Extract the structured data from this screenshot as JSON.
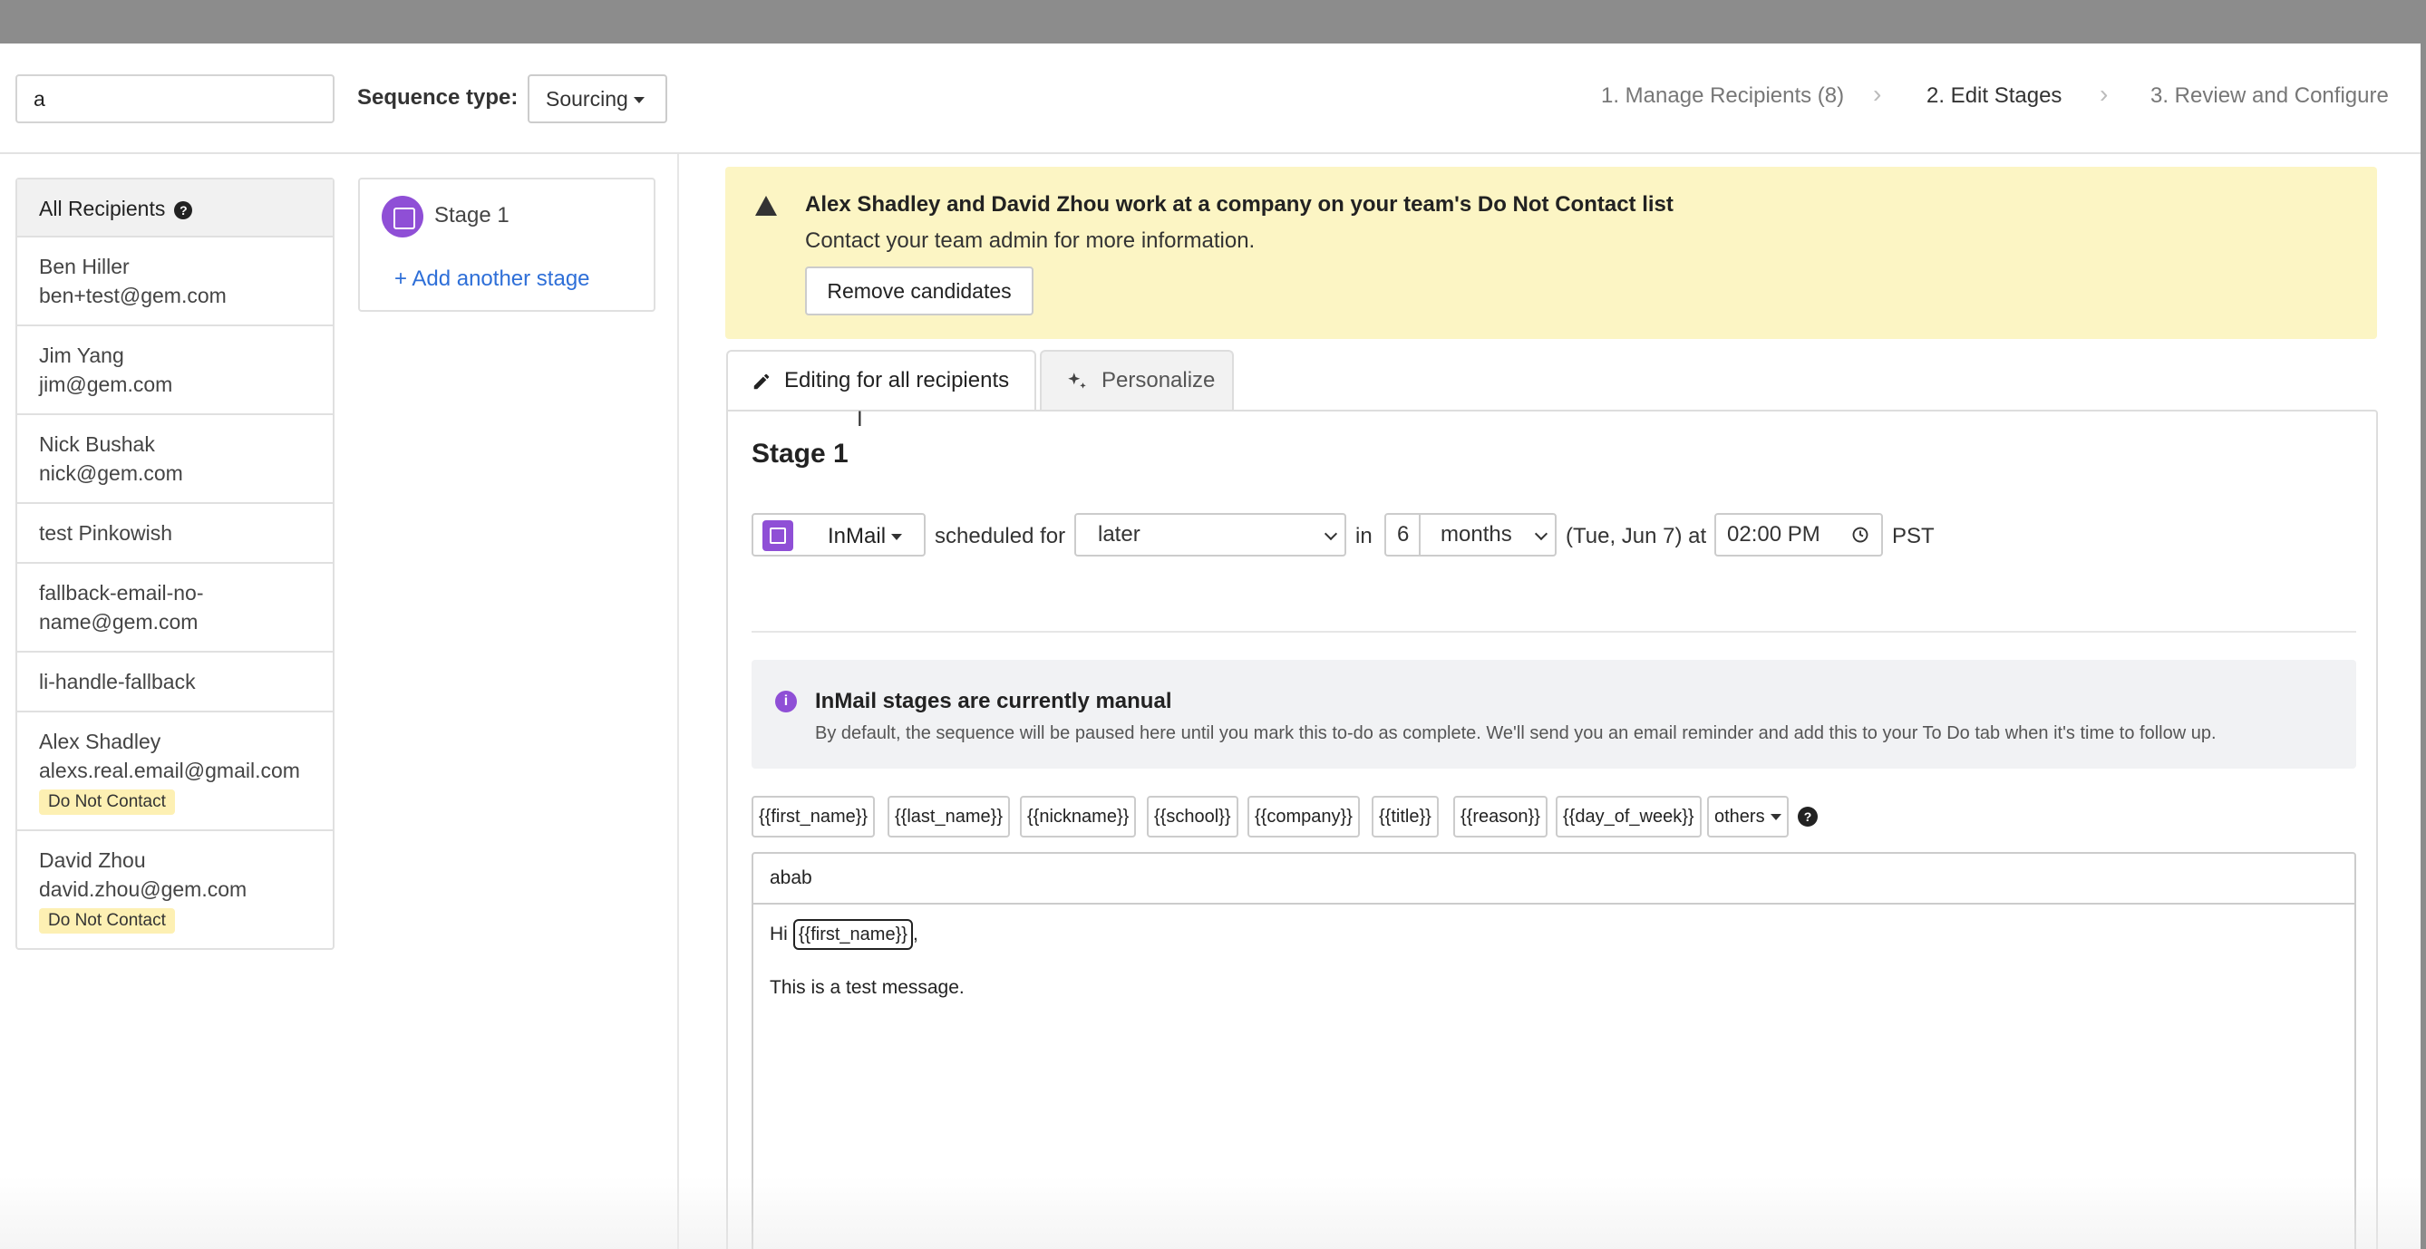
{
  "header": {
    "search_value": "a",
    "sequence_type_label": "Sequence type:",
    "sequence_type_value": "Sourcing",
    "steps": [
      "1. Manage Recipients (8)",
      "2. Edit Stages",
      "3. Review and Configure"
    ],
    "step_separator": "›"
  },
  "recipients": {
    "all_label": "All Recipients",
    "help_glyph": "?",
    "items": [
      {
        "name": "Ben Hiller",
        "email": "ben+test@gem.com",
        "badge": ""
      },
      {
        "name": "Jim Yang",
        "email": "jim@gem.com",
        "badge": ""
      },
      {
        "name": "Nick Bushak",
        "email": "nick@gem.com",
        "badge": ""
      },
      {
        "name": "test Pinkowish",
        "email": "",
        "badge": ""
      },
      {
        "name": "fallback-email-no-",
        "email": "name@gem.com",
        "badge": ""
      },
      {
        "name": "li-handle-fallback",
        "email": "",
        "badge": ""
      },
      {
        "name": "Alex Shadley",
        "email": "alexs.real.email@gmail.com",
        "badge": "Do Not Contact"
      },
      {
        "name": "David Zhou",
        "email": "david.zhou@gem.com",
        "badge": "Do Not Contact"
      }
    ]
  },
  "stages": {
    "items": [
      {
        "label": "Stage 1"
      }
    ],
    "add_label": "+ Add another stage"
  },
  "alert": {
    "title": "Alex Shadley and David Zhou work at a company on your team's Do Not Contact list",
    "subtitle": "Contact your team admin for more information.",
    "button_label": "Remove candidates"
  },
  "tabs": {
    "editing_label": "Editing for all recipients",
    "personalize_label": "Personalize"
  },
  "stage_editor": {
    "title": "Stage 1",
    "type_label": "InMail",
    "scheduled_for_label": "scheduled for",
    "timing_value": "later",
    "in_label": "in",
    "amount_value": "6",
    "unit_value": "months",
    "date_text": "(Tue, Jun 7) at",
    "time_value": "02:00 PM",
    "timezone": "PST",
    "info_title": "InMail stages are currently manual",
    "info_body": "By default, the sequence will be paused here until you mark this to-do as complete. We'll send you an email reminder and add this to your To Do tab when it's time to follow up.",
    "info_glyph": "i",
    "tokens": [
      "{{first_name}}",
      "{{last_name}}",
      "{{nickname}}",
      "{{school}}",
      "{{company}}",
      "{{title}}",
      "{{reason}}",
      "{{day_of_week}}"
    ],
    "others_label": "others",
    "help_glyph": "?",
    "subject": "abab",
    "body_greeting": "Hi",
    "body_token": "{{first_name}}",
    "body_comma": ",",
    "body_line2": "This is a test message."
  },
  "colors": {
    "accent_purple": "#8f4fd6",
    "link_blue": "#2e6fd8",
    "alert_bg": "#fcf5c4",
    "badge_bg": "#fdf0b3"
  },
  "icons": [
    "warning-icon",
    "pencil-icon",
    "sparkle-icon",
    "help-icon",
    "info-icon",
    "clock-icon",
    "inmail-icon",
    "chevron-right-icon"
  ]
}
